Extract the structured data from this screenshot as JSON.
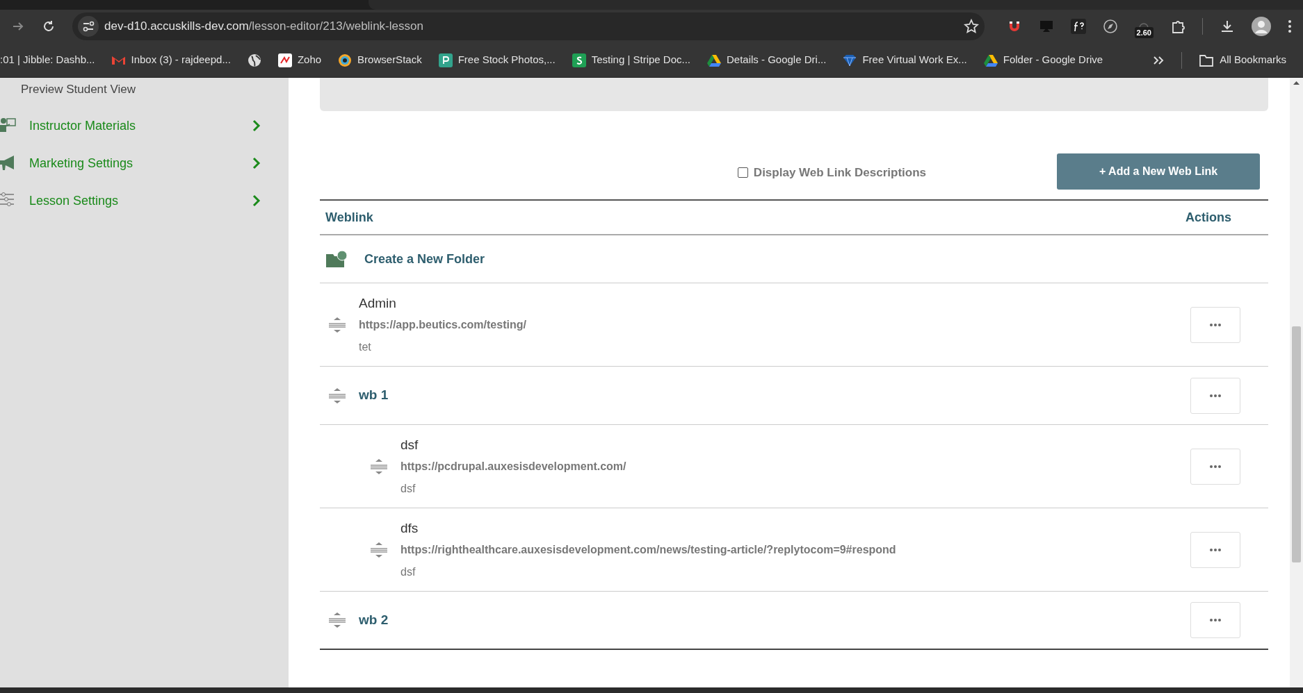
{
  "browser": {
    "url_host": "dev-d10.accuskills-dev.com",
    "url_path": "/lesson-editor/213/weblink-lesson",
    "timer_badge": "2.60",
    "bookmarks": [
      {
        "label": ":01 | Jibble: Dashb...",
        "kind": "none"
      },
      {
        "label": "Inbox (3) - rajdeepd...",
        "kind": "mail"
      },
      {
        "kind": "globe"
      },
      {
        "label": "Zoho",
        "kind": "zoho"
      },
      {
        "label": "BrowserStack",
        "kind": "ring"
      },
      {
        "label": "Free Stock Photos,...",
        "kind": "teal"
      },
      {
        "label": "Testing | Stripe Doc...",
        "kind": "stripe"
      },
      {
        "label": "Details - Google Dri...",
        "kind": "drive"
      },
      {
        "label": "Free Virtual Work Ex...",
        "kind": "gem"
      },
      {
        "label": "Folder - Google Drive",
        "kind": "drive"
      }
    ],
    "all_bookmarks": "All Bookmarks"
  },
  "sidebar": {
    "preview_link": "Preview Student View",
    "items": [
      {
        "label": "Instructor Materials",
        "kind": "presenter"
      },
      {
        "label": "Marketing Settings",
        "kind": "megaphone"
      },
      {
        "label": "Lesson Settings",
        "kind": "sliders"
      }
    ]
  },
  "toolbar": {
    "checkbox": {
      "label": "Display Web Link Descriptions",
      "checked": false
    },
    "add_button": "+ Add a New Web Link"
  },
  "table": {
    "columns": [
      "Weblink",
      "Actions"
    ],
    "create_folder": "Create a New Folder",
    "rows": [
      {
        "kind": "link",
        "title": "Admin",
        "url": "https://app.beutics.com/testing/",
        "description": "tet"
      },
      {
        "kind": "folder",
        "title": "wb 1",
        "children": [
          {
            "kind": "link",
            "title": "dsf",
            "url": "https://pcdrupal.auxesisdevelopment.com/",
            "description": "dsf"
          },
          {
            "kind": "link",
            "title": "dfs",
            "url": "https://righthealthcare.auxesisdevelopment.com/news/testing-article/?replytocom=9#respond",
            "description": "dsf"
          }
        ]
      },
      {
        "kind": "folder",
        "title": "wb 2"
      }
    ]
  }
}
